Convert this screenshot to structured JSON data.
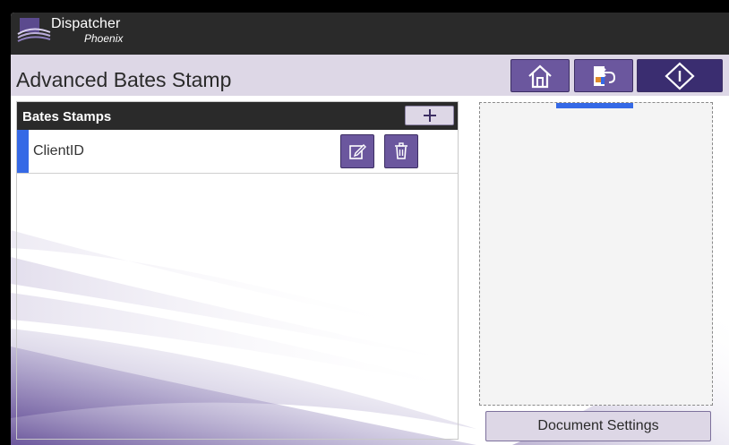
{
  "brand": {
    "name": "Dispatcher",
    "sub": "Phoenix"
  },
  "page": {
    "title": "Advanced Bates Stamp"
  },
  "nav": {
    "home_icon": "home-icon",
    "back_icon": "back-to-workflow-icon",
    "start_icon": "start-diamond-icon"
  },
  "bates_stamps": {
    "header": "Bates Stamps",
    "add_icon": "plus-icon",
    "items": [
      {
        "label": "ClientID",
        "edit_icon": "edit-icon",
        "delete_icon": "trash-icon"
      }
    ]
  },
  "preview": {
    "footer_button": "Document Settings"
  },
  "colors": {
    "accent_blue": "#3569e6",
    "button_purple": "#6b579e",
    "start_purple": "#3a2d70",
    "light_lavender": "#ddd7e6",
    "header_dark": "#2a2a2a"
  }
}
